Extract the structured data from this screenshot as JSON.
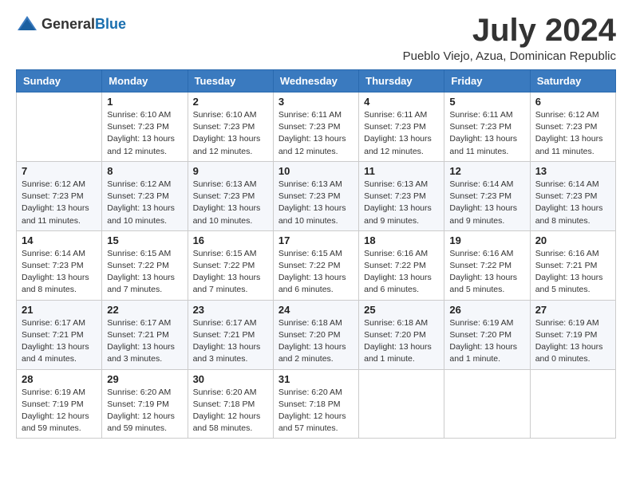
{
  "header": {
    "logo_general": "General",
    "logo_blue": "Blue",
    "month_title": "July 2024",
    "location": "Pueblo Viejo, Azua, Dominican Republic"
  },
  "weekdays": [
    "Sunday",
    "Monday",
    "Tuesday",
    "Wednesday",
    "Thursday",
    "Friday",
    "Saturday"
  ],
  "weeks": [
    [
      {
        "day": "",
        "info": ""
      },
      {
        "day": "1",
        "info": "Sunrise: 6:10 AM\nSunset: 7:23 PM\nDaylight: 13 hours\nand 12 minutes."
      },
      {
        "day": "2",
        "info": "Sunrise: 6:10 AM\nSunset: 7:23 PM\nDaylight: 13 hours\nand 12 minutes."
      },
      {
        "day": "3",
        "info": "Sunrise: 6:11 AM\nSunset: 7:23 PM\nDaylight: 13 hours\nand 12 minutes."
      },
      {
        "day": "4",
        "info": "Sunrise: 6:11 AM\nSunset: 7:23 PM\nDaylight: 13 hours\nand 12 minutes."
      },
      {
        "day": "5",
        "info": "Sunrise: 6:11 AM\nSunset: 7:23 PM\nDaylight: 13 hours\nand 11 minutes."
      },
      {
        "day": "6",
        "info": "Sunrise: 6:12 AM\nSunset: 7:23 PM\nDaylight: 13 hours\nand 11 minutes."
      }
    ],
    [
      {
        "day": "7",
        "info": "Sunrise: 6:12 AM\nSunset: 7:23 PM\nDaylight: 13 hours\nand 11 minutes."
      },
      {
        "day": "8",
        "info": "Sunrise: 6:12 AM\nSunset: 7:23 PM\nDaylight: 13 hours\nand 10 minutes."
      },
      {
        "day": "9",
        "info": "Sunrise: 6:13 AM\nSunset: 7:23 PM\nDaylight: 13 hours\nand 10 minutes."
      },
      {
        "day": "10",
        "info": "Sunrise: 6:13 AM\nSunset: 7:23 PM\nDaylight: 13 hours\nand 10 minutes."
      },
      {
        "day": "11",
        "info": "Sunrise: 6:13 AM\nSunset: 7:23 PM\nDaylight: 13 hours\nand 9 minutes."
      },
      {
        "day": "12",
        "info": "Sunrise: 6:14 AM\nSunset: 7:23 PM\nDaylight: 13 hours\nand 9 minutes."
      },
      {
        "day": "13",
        "info": "Sunrise: 6:14 AM\nSunset: 7:23 PM\nDaylight: 13 hours\nand 8 minutes."
      }
    ],
    [
      {
        "day": "14",
        "info": "Sunrise: 6:14 AM\nSunset: 7:23 PM\nDaylight: 13 hours\nand 8 minutes."
      },
      {
        "day": "15",
        "info": "Sunrise: 6:15 AM\nSunset: 7:22 PM\nDaylight: 13 hours\nand 7 minutes."
      },
      {
        "day": "16",
        "info": "Sunrise: 6:15 AM\nSunset: 7:22 PM\nDaylight: 13 hours\nand 7 minutes."
      },
      {
        "day": "17",
        "info": "Sunrise: 6:15 AM\nSunset: 7:22 PM\nDaylight: 13 hours\nand 6 minutes."
      },
      {
        "day": "18",
        "info": "Sunrise: 6:16 AM\nSunset: 7:22 PM\nDaylight: 13 hours\nand 6 minutes."
      },
      {
        "day": "19",
        "info": "Sunrise: 6:16 AM\nSunset: 7:22 PM\nDaylight: 13 hours\nand 5 minutes."
      },
      {
        "day": "20",
        "info": "Sunrise: 6:16 AM\nSunset: 7:21 PM\nDaylight: 13 hours\nand 5 minutes."
      }
    ],
    [
      {
        "day": "21",
        "info": "Sunrise: 6:17 AM\nSunset: 7:21 PM\nDaylight: 13 hours\nand 4 minutes."
      },
      {
        "day": "22",
        "info": "Sunrise: 6:17 AM\nSunset: 7:21 PM\nDaylight: 13 hours\nand 3 minutes."
      },
      {
        "day": "23",
        "info": "Sunrise: 6:17 AM\nSunset: 7:21 PM\nDaylight: 13 hours\nand 3 minutes."
      },
      {
        "day": "24",
        "info": "Sunrise: 6:18 AM\nSunset: 7:20 PM\nDaylight: 13 hours\nand 2 minutes."
      },
      {
        "day": "25",
        "info": "Sunrise: 6:18 AM\nSunset: 7:20 PM\nDaylight: 13 hours\nand 1 minute."
      },
      {
        "day": "26",
        "info": "Sunrise: 6:19 AM\nSunset: 7:20 PM\nDaylight: 13 hours\nand 1 minute."
      },
      {
        "day": "27",
        "info": "Sunrise: 6:19 AM\nSunset: 7:19 PM\nDaylight: 13 hours\nand 0 minutes."
      }
    ],
    [
      {
        "day": "28",
        "info": "Sunrise: 6:19 AM\nSunset: 7:19 PM\nDaylight: 12 hours\nand 59 minutes."
      },
      {
        "day": "29",
        "info": "Sunrise: 6:20 AM\nSunset: 7:19 PM\nDaylight: 12 hours\nand 59 minutes."
      },
      {
        "day": "30",
        "info": "Sunrise: 6:20 AM\nSunset: 7:18 PM\nDaylight: 12 hours\nand 58 minutes."
      },
      {
        "day": "31",
        "info": "Sunrise: 6:20 AM\nSunset: 7:18 PM\nDaylight: 12 hours\nand 57 minutes."
      },
      {
        "day": "",
        "info": ""
      },
      {
        "day": "",
        "info": ""
      },
      {
        "day": "",
        "info": ""
      }
    ]
  ]
}
